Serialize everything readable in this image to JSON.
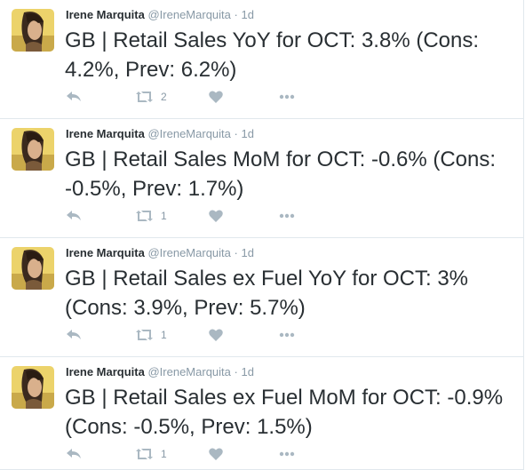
{
  "tweets": [
    {
      "author": "Irene Marquita",
      "handle": "@IreneMarquita",
      "separator": "·",
      "time": "1d",
      "text": "GB | Retail Sales YoY for OCT: 3.8% (Cons: 4.2%, Prev: 6.2%)",
      "retweets": "2"
    },
    {
      "author": "Irene Marquita",
      "handle": "@IreneMarquita",
      "separator": "·",
      "time": "1d",
      "text": "GB | Retail Sales MoM for OCT: -0.6% (Cons: -0.5%, Prev: 1.7%)",
      "retweets": "1"
    },
    {
      "author": "Irene Marquita",
      "handle": "@IreneMarquita",
      "separator": "·",
      "time": "1d",
      "text": "GB | Retail Sales ex Fuel YoY for OCT: 3% (Cons: 3.9%, Prev: 5.7%)",
      "retweets": "1"
    },
    {
      "author": "Irene Marquita",
      "handle": "@IreneMarquita",
      "separator": "·",
      "time": "1d",
      "text": "GB | Retail Sales ex Fuel MoM for OCT: -0.9% (Cons: -0.5%, Prev: 1.5%)",
      "retweets": "1"
    }
  ],
  "icons": {
    "reply": "reply-icon",
    "retweet": "retweet-icon",
    "like": "heart-icon",
    "more": "more-icon"
  },
  "colors": {
    "text": "#292f33",
    "muted": "#8899a6",
    "icon": "#aab8c2",
    "border": "#e1e8ed"
  }
}
